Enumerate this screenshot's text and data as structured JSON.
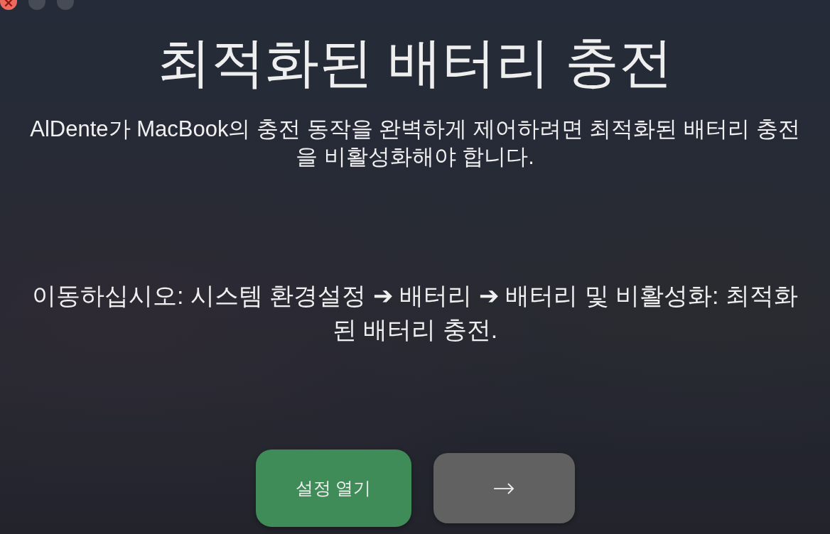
{
  "window_controls": [
    {
      "kind": "close",
      "disabled": false
    },
    {
      "kind": "minimize",
      "disabled": true
    },
    {
      "kind": "zoom",
      "disabled": true
    }
  ],
  "title": "최적화된 배터리 충전",
  "paragraphs": [
    "AlDente가 MacBook의 충전 동작을 완벽하게 제어하려면 최적화된 배터리 충전을 비활성화해야 합니다.",
    "이동하십시오: 시스템 환경설정 ➔ 배터리 ➔ 배터리 및 비활성화: 최적화된 배터리 충전."
  ],
  "buttons": [
    {
      "kind": "primary",
      "label": "설정 열기"
    },
    {
      "kind": "secondary",
      "label": "→"
    }
  ]
}
